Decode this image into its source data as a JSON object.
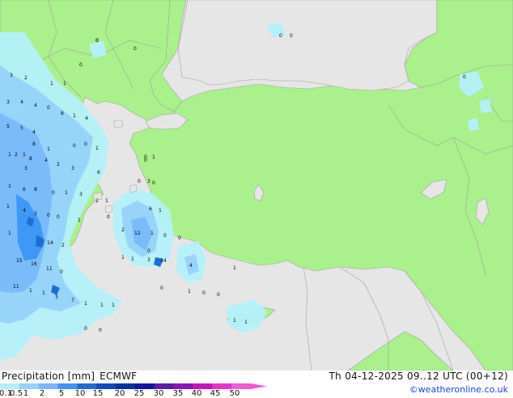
{
  "header": {
    "variable": "Precipitation [mm]",
    "model": "ECMWF",
    "datetime": "Th 04-12-2025 09..12 UTC (00+12)",
    "credit": "©weatheronline.co.uk"
  },
  "legend": {
    "labels": [
      "0.1",
      "0.5",
      "1",
      "2",
      "5",
      "10",
      "15",
      "20",
      "25",
      "30",
      "35",
      "40",
      "45",
      "50"
    ],
    "colors": [
      "#b4f0fa",
      "#96d2fa",
      "#78b9fa",
      "#3c96f5",
      "#1e6ed2",
      "#0a4bbe",
      "#0032a0",
      "#1414a0",
      "#5a1eaa",
      "#8c14be",
      "#c814be",
      "#e632c8",
      "#f05ad2"
    ]
  },
  "map": {
    "land_color": "#aaf08c",
    "sea_color": "#e6e6e6",
    "border_color": "#a0a0a0",
    "point_values": [
      {
        "v": "0"
      },
      {
        "v": "0"
      },
      {
        "v": "0"
      },
      {
        "v": "0"
      },
      {
        "v": "0"
      },
      {
        "v": "0"
      },
      {
        "v": "3"
      },
      {
        "v": "2"
      },
      {
        "v": "1"
      },
      {
        "v": "1"
      },
      {
        "v": "3"
      },
      {
        "v": "4"
      },
      {
        "v": "4"
      },
      {
        "v": "0"
      },
      {
        "v": "8"
      },
      {
        "v": "1"
      },
      {
        "v": "4"
      },
      {
        "v": "5"
      },
      {
        "v": "5"
      },
      {
        "v": "4"
      },
      {
        "v": "0"
      },
      {
        "v": "1"
      },
      {
        "v": "8"
      },
      {
        "v": "1"
      },
      {
        "v": "0"
      },
      {
        "v": "1"
      },
      {
        "v": "1"
      },
      {
        "v": "2"
      },
      {
        "v": "3"
      },
      {
        "v": "8"
      },
      {
        "v": "4"
      },
      {
        "v": "2"
      },
      {
        "v": "3"
      },
      {
        "v": "6"
      },
      {
        "v": "1"
      },
      {
        "v": "6"
      },
      {
        "v": "8"
      },
      {
        "v": "0"
      },
      {
        "v": "1"
      },
      {
        "v": "3"
      },
      {
        "v": "2"
      },
      {
        "v": "1"
      },
      {
        "v": "4"
      },
      {
        "v": "3"
      },
      {
        "v": "0"
      },
      {
        "v": "0"
      },
      {
        "v": "1"
      },
      {
        "v": "1"
      },
      {
        "v": "14"
      },
      {
        "v": "2"
      },
      {
        "v": "1"
      },
      {
        "v": "15"
      },
      {
        "v": "16"
      },
      {
        "v": "11"
      },
      {
        "v": "0"
      },
      {
        "v": "11"
      },
      {
        "v": "1"
      },
      {
        "v": "1"
      },
      {
        "v": "3"
      },
      {
        "v": "7"
      },
      {
        "v": "1"
      },
      {
        "v": "1"
      },
      {
        "v": "1"
      },
      {
        "v": "0"
      },
      {
        "v": "0"
      },
      {
        "v": "0"
      },
      {
        "v": "1"
      },
      {
        "v": "0"
      },
      {
        "v": "3"
      },
      {
        "v": "6"
      },
      {
        "v": "1"
      },
      {
        "v": "2"
      },
      {
        "v": "12"
      },
      {
        "v": "1"
      },
      {
        "v": "0"
      },
      {
        "v": "0"
      },
      {
        "v": "1"
      },
      {
        "v": "1"
      },
      {
        "v": "3"
      },
      {
        "v": "14"
      },
      {
        "v": "4"
      },
      {
        "v": "1"
      },
      {
        "v": "0"
      },
      {
        "v": "1"
      },
      {
        "v": "0"
      },
      {
        "v": "0"
      },
      {
        "v": "1"
      },
      {
        "v": "1"
      },
      {
        "v": "0"
      },
      {
        "v": "0"
      },
      {
        "v": "0"
      },
      {
        "v": "0"
      },
      {
        "v": "0"
      }
    ]
  }
}
